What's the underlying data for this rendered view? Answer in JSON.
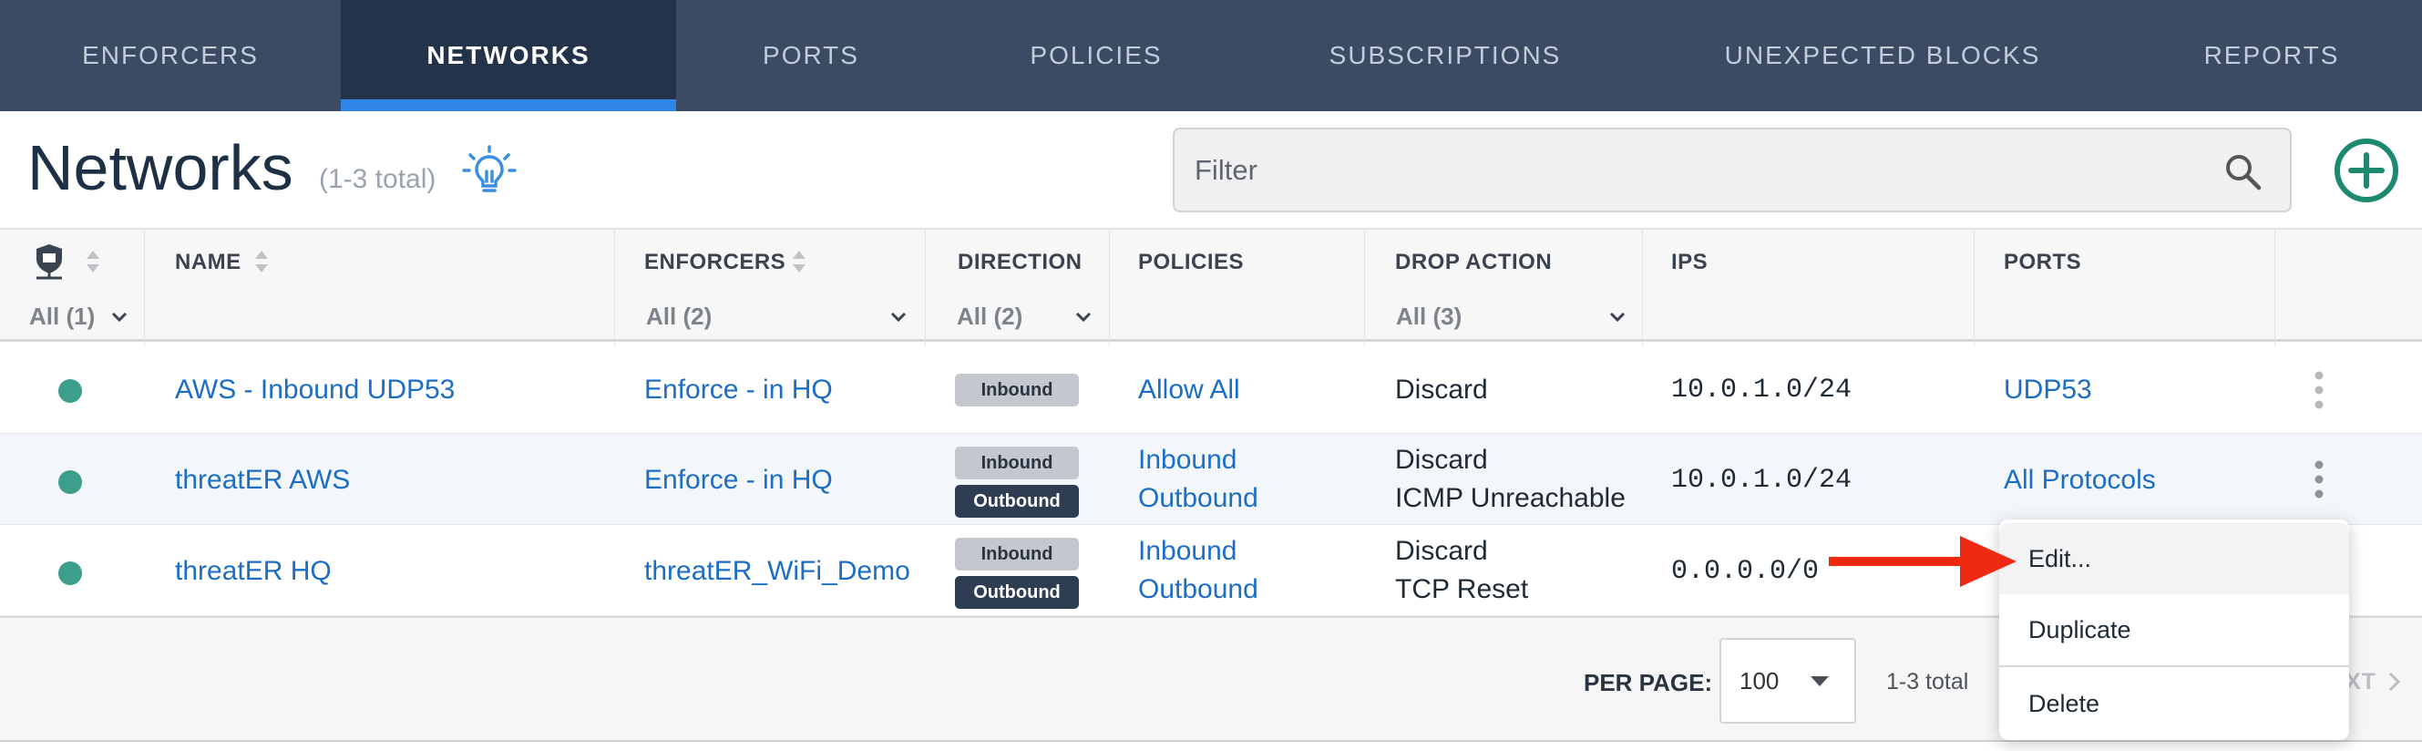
{
  "nav": {
    "tabs": [
      {
        "label": "ENFORCERS"
      },
      {
        "label": "NETWORKS"
      },
      {
        "label": "PORTS"
      },
      {
        "label": "POLICIES"
      },
      {
        "label": "SUBSCRIPTIONS"
      },
      {
        "label": "UNEXPECTED BLOCKS"
      },
      {
        "label": "REPORTS"
      }
    ],
    "active_tab": "NETWORKS"
  },
  "header": {
    "title": "Networks",
    "count": "(1-3 total)",
    "filter_placeholder": "Filter"
  },
  "table": {
    "columns": {
      "name": "NAME",
      "enforcers": "ENFORCERS",
      "direction": "DIRECTION",
      "policies": "POLICIES",
      "drop_action": "DROP ACTION",
      "ips": "IPS",
      "ports": "PORTS"
    },
    "filters": {
      "status": "All (1)",
      "enforcers": "All (2)",
      "direction": "All (2)",
      "drop_action": "All (3)"
    },
    "rows": [
      {
        "status": "active",
        "name": "AWS - Inbound UDP53",
        "enforcer": "Enforce - in HQ",
        "direction": [
          "Inbound"
        ],
        "policies": [
          "Allow All"
        ],
        "drop_action": [
          "Discard"
        ],
        "ips": "10.0.1.0/24",
        "ports": "UDP53"
      },
      {
        "status": "active",
        "name": "threatER AWS",
        "enforcer": "Enforce - in HQ",
        "direction": [
          "Inbound",
          "Outbound"
        ],
        "policies": [
          "Inbound",
          "Outbound"
        ],
        "drop_action": [
          "Discard",
          "ICMP Unreachable"
        ],
        "ips": "10.0.1.0/24",
        "ports": "All Protocols"
      },
      {
        "status": "active",
        "name": "threatER HQ",
        "enforcer": "threatER_WiFi_Demo",
        "direction": [
          "Inbound",
          "Outbound"
        ],
        "policies": [
          "Inbound",
          "Outbound"
        ],
        "drop_action": [
          "Discard",
          "TCP Reset"
        ],
        "ips": "0.0.0.0/0",
        "ports": ""
      }
    ]
  },
  "footer": {
    "per_page_label": "PER PAGE:",
    "per_page_value": "100",
    "range": "1-3 total",
    "next": "XT"
  },
  "context_menu": {
    "items": [
      {
        "label": "Edit..."
      },
      {
        "label": "Duplicate"
      },
      {
        "label": "Delete"
      }
    ]
  },
  "colors": {
    "nav_bg": "#3a4b63",
    "nav_active_bg": "#24334a",
    "nav_active_underline": "#2f86e6",
    "link": "#1c6ec4",
    "status_dot": "#3d9e8c",
    "add_button": "#1d8a6f",
    "annotation_arrow": "#ee2a12"
  },
  "icons": {
    "header": "lightbulb-icon",
    "filter": "search-icon",
    "add": "plus-circle-icon",
    "status_column": "shield-network-icon",
    "row_actions": "kebab-icon"
  }
}
